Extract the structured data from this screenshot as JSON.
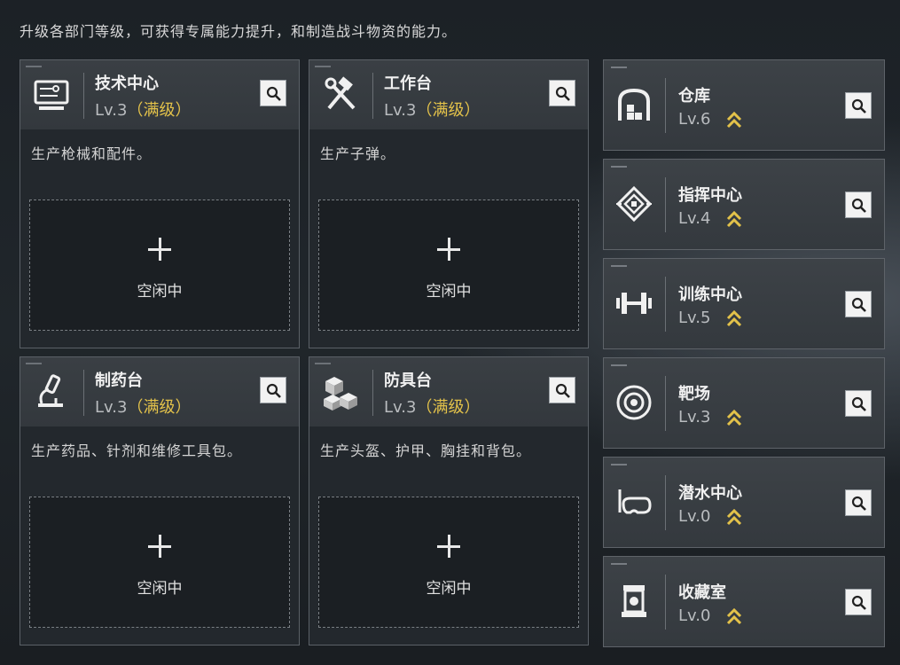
{
  "description": "升级各部门等级，可获得专属能力提升，和制造战斗物资的能力。",
  "colors": {
    "accent_gold": "#e3c24a",
    "panel": "#3a3f44",
    "slot": "#1b1f23"
  },
  "workshops": [
    {
      "name": "技术中心",
      "level": "Lv.3",
      "max": "（满级）",
      "icon": "computer-icon",
      "produce": "生产枪械和配件。",
      "slot_label": "空闲中"
    },
    {
      "name": "工作台",
      "level": "Lv.3",
      "max": "（满级）",
      "icon": "hammer-wrench-icon",
      "produce": "生产子弹。",
      "slot_label": "空闲中"
    },
    {
      "name": "制药台",
      "level": "Lv.3",
      "max": "（满级）",
      "icon": "microscope-icon",
      "produce": "生产药品、针剂和维修工具包。",
      "slot_label": "空闲中"
    },
    {
      "name": "防具台",
      "level": "Lv.3",
      "max": "（满级）",
      "icon": "cubes-icon",
      "produce": "生产头盔、护甲、胸挂和背包。",
      "slot_label": "空闲中"
    }
  ],
  "facilities": [
    {
      "name": "仓库",
      "level": "Lv.6",
      "icon": "warehouse-icon"
    },
    {
      "name": "指挥中心",
      "level": "Lv.4",
      "icon": "command-chip-icon"
    },
    {
      "name": "训练中心",
      "level": "Lv.5",
      "icon": "dumbbell-icon"
    },
    {
      "name": "靶场",
      "level": "Lv.3",
      "icon": "target-icon"
    },
    {
      "name": "潜水中心",
      "level": "Lv.0",
      "icon": "diving-mask-icon"
    },
    {
      "name": "收藏室",
      "level": "Lv.0",
      "icon": "display-case-icon"
    }
  ]
}
